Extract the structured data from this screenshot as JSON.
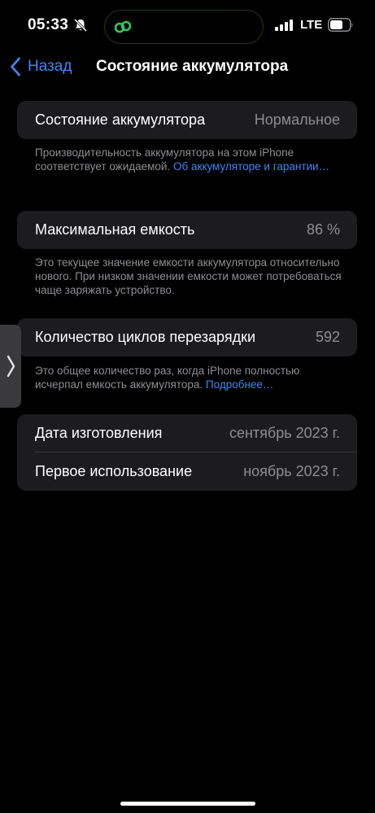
{
  "status_bar": {
    "time": "05:33",
    "network": "LTE",
    "accent_green": "#34c759"
  },
  "nav": {
    "back_label": "Назад",
    "title": "Состояние аккумулятора"
  },
  "sections": {
    "health": {
      "label": "Состояние аккумулятора",
      "value": "Нормальное",
      "footnote_text": "Производительность аккумулятора на этом iPhone соответствует ожидаемой. ",
      "footnote_link": "Об аккумуляторе и гарантии…"
    },
    "capacity": {
      "label": "Максимальная емкость",
      "value": "86 %",
      "footnote_text": "Это текущее значение емкости аккумулятора относительно нового. При низком значении емкости может потребоваться чаще заряжать устройство."
    },
    "cycles": {
      "label": "Количество циклов перезарядки",
      "value": "592",
      "footnote_text": "Это общее количество раз, когда iPhone полностью исчерпал емкость аккумулятора. ",
      "footnote_link": "Подробнее…"
    },
    "dates": {
      "manufacture_label": "Дата изготовления",
      "manufacture_value": "сентябрь 2023 г.",
      "first_use_label": "Первое использование",
      "first_use_value": "ноябрь 2023 г."
    }
  },
  "colors": {
    "background": "#000000",
    "card": "#1c1c1e",
    "link": "#3e86f5",
    "secondary_text": "#8e8e93"
  },
  "icons": {
    "bell": "bell-slash-icon",
    "island": "link-icon",
    "signal": "cellular-signal-icon",
    "battery": "battery-icon",
    "back": "chevron-left-icon",
    "handle": "chevron-right-icon"
  }
}
